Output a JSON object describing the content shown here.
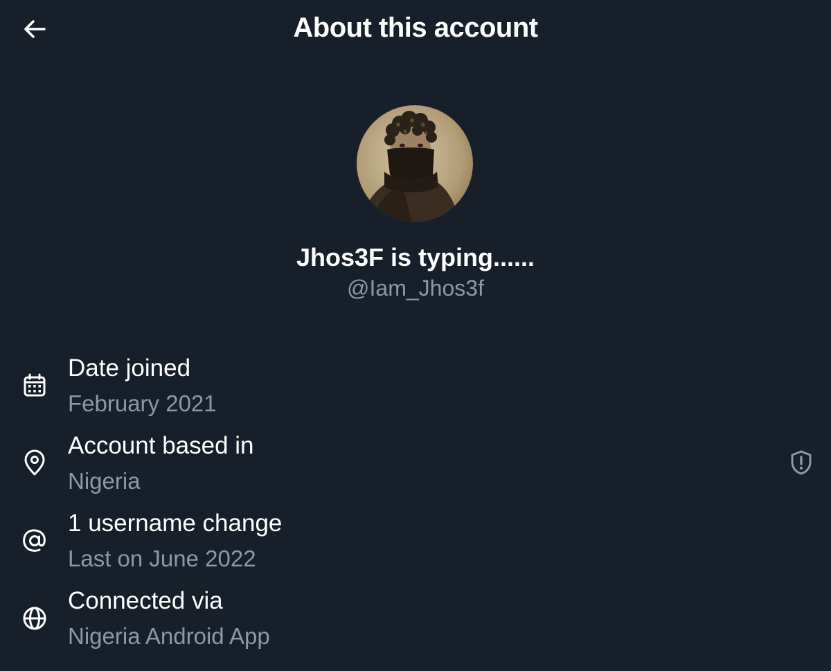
{
  "header": {
    "title": "About this account",
    "back_icon": "arrow-left-icon"
  },
  "profile": {
    "display_name": "Jhos3F is typing......",
    "handle": "@Iam_Jhos3f",
    "avatar": "profile-photo"
  },
  "info": [
    {
      "icon": "calendar-icon",
      "label": "Date joined",
      "value": "February 2021"
    },
    {
      "icon": "location-pin-icon",
      "label": "Account based in",
      "value": "Nigeria"
    },
    {
      "icon": "at-sign-icon",
      "label": "1 username change",
      "value": "Last on June 2022"
    },
    {
      "icon": "globe-icon",
      "label": "Connected via",
      "value": "Nigeria Android App"
    }
  ],
  "colors": {
    "background": "#17202a",
    "primary_text": "#ffffff",
    "secondary_text": "#8b98a5"
  },
  "location_info_icon": "shield-alert-icon"
}
